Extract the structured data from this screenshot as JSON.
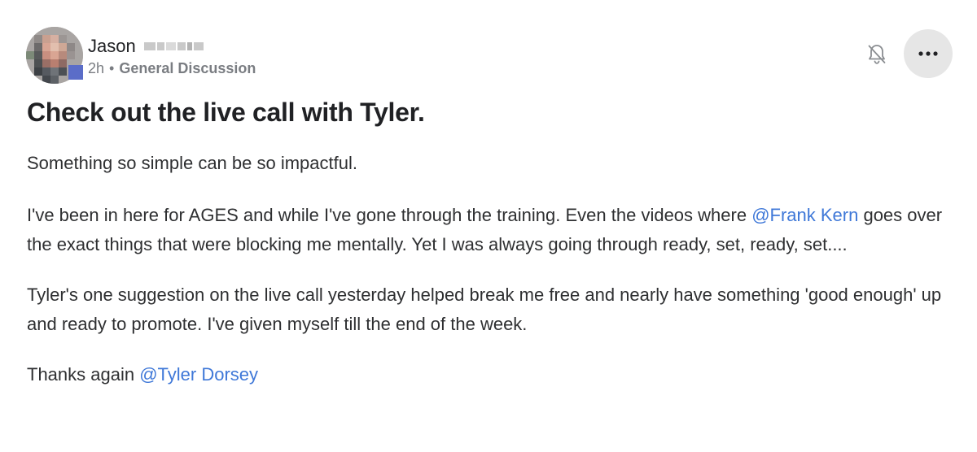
{
  "author": {
    "name": "Jason",
    "time": "2h",
    "separator": "•",
    "category": "General Discussion"
  },
  "actions": {
    "notify_icon": "bell-off-icon",
    "more_icon": "more-horizontal-icon"
  },
  "post": {
    "title": "Check out the live call with Tyler.",
    "p1": "Something so simple can be so impactful.",
    "p2_before": "I've been in here for AGES and while I've gone through the training. Even the videos where ",
    "p2_mention": "@Frank Kern",
    "p2_after": " goes over the exact things that were blocking me mentally. Yet I was always going through ready, set, ready, set....",
    "p3": "Tyler's one suggestion on the live call yesterday helped break me free and nearly have something 'good enough' up and ready to promote. I've given myself till the end of the week.",
    "p4_before": "Thanks again ",
    "p4_mention": "@Tyler Dorsey"
  },
  "colors": {
    "mention": "#3f78d8",
    "meta": "#7a7d82",
    "more_button_bg": "#e6e6e6"
  }
}
